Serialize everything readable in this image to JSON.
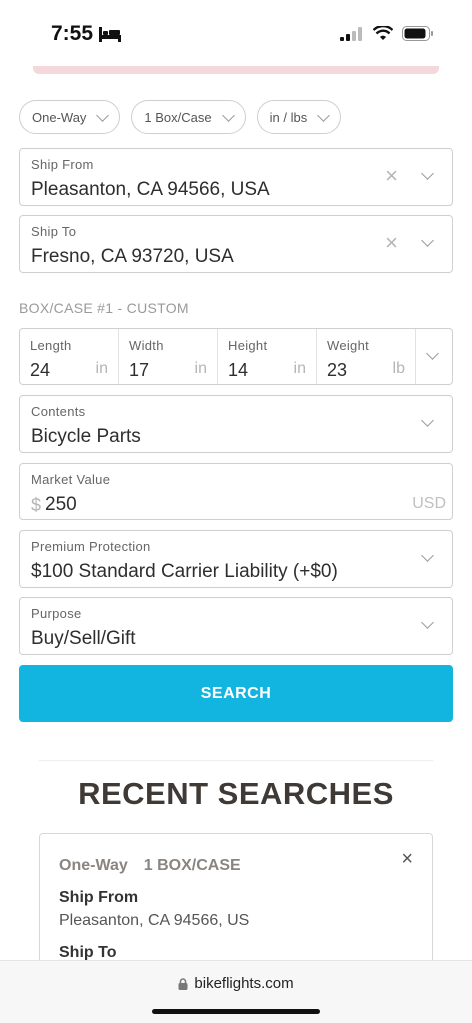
{
  "status_bar": {
    "time": "7:55"
  },
  "pills": [
    {
      "label": "One-Way"
    },
    {
      "label": "1 Box/Case"
    },
    {
      "label": "in / lbs"
    }
  ],
  "ship_from": {
    "label": "Ship From",
    "value": "Pleasanton, CA 94566, USA"
  },
  "ship_to": {
    "label": "Ship To",
    "value": "Fresno, CA 93720, USA"
  },
  "box_section_label": "BOX/CASE #1 - CUSTOM",
  "dimensions": [
    {
      "label": "Length",
      "value": "24",
      "unit": "in"
    },
    {
      "label": "Width",
      "value": "17",
      "unit": "in"
    },
    {
      "label": "Height",
      "value": "14",
      "unit": "in"
    },
    {
      "label": "Weight",
      "value": "23",
      "unit": "lb"
    }
  ],
  "contents": {
    "label": "Contents",
    "value": "Bicycle Parts"
  },
  "market_value": {
    "label": "Market Value",
    "currency_symbol": "$",
    "value": "250",
    "currency": "USD"
  },
  "protection": {
    "label": "Premium Protection",
    "value": "$100 Standard Carrier Liability (+$0)"
  },
  "purpose": {
    "label": "Purpose",
    "value": "Buy/Sell/Gift"
  },
  "search_button": "SEARCH",
  "recent": {
    "title": "RECENT SEARCHES",
    "card": {
      "trip_type": "One-Way",
      "box_count": "1 BOX/CASE",
      "close": "×",
      "ship_from_label": "Ship From",
      "ship_from_value": "Pleasanton, CA 94566, US",
      "ship_to_label": "Ship To"
    }
  },
  "browser": {
    "url": "bikeflights.com"
  },
  "colors": {
    "accent": "#12b5e0",
    "border": "#cfcfcf",
    "heading": "#3f3a36"
  }
}
